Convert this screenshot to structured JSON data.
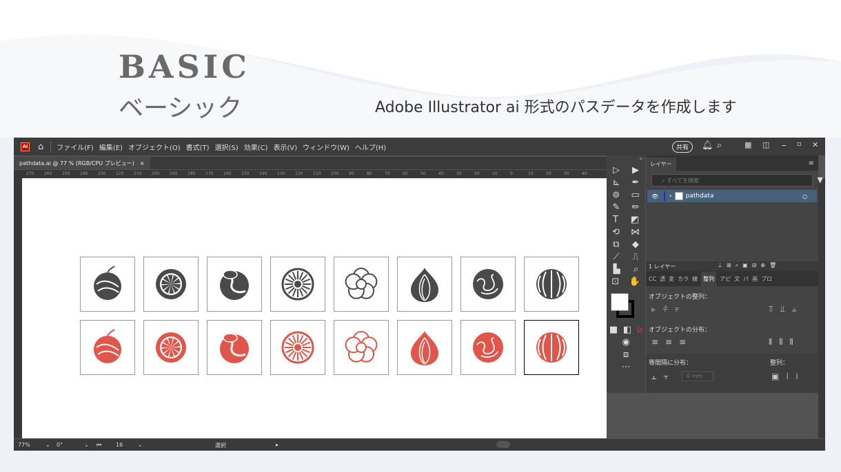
{
  "hero": {
    "title_en": "BASIC",
    "title_jp": "ベーシック",
    "subtitle": "Adobe Illustrator ai 形式のパスデータを作成します"
  },
  "app": {
    "logo": "Ai",
    "menu": [
      "ファイル(F)",
      "編集(E)",
      "オブジェクト(O)",
      "書式(T)",
      "選択(S)",
      "効果(C)",
      "表示(V)",
      "ウィンドウ(W)",
      "ヘルプ(H)"
    ],
    "share_label": "共有",
    "doc_tab": "pathdata.ai @ 77 % (RGB/CPU プレビュー)",
    "doc_tab_close": "×",
    "ruler_ticks": [
      "270",
      "260",
      "250",
      "240",
      "230",
      "220",
      "210",
      "200",
      "190",
      "180",
      "170",
      "160",
      "150",
      "140",
      "130",
      "120",
      "110",
      "100",
      "90",
      "80",
      "70",
      "60",
      "50",
      "40",
      "30",
      "20",
      "10",
      "0",
      "10",
      "20",
      "30",
      "40"
    ],
    "status": {
      "zoom": "77%",
      "rotate": "0°",
      "artboard": "16",
      "tool": "選択"
    }
  },
  "layers_panel": {
    "tab": "レイヤー",
    "search_placeholder": "すべてを検索",
    "layer_name": "pathdata",
    "layer_count": "1 レイヤー"
  },
  "align_panel": {
    "tabs": [
      "CC",
      "透",
      "変",
      "カラ",
      "線",
      "整列",
      "アピ",
      "文",
      "パ",
      "画",
      "プロ"
    ],
    "active_tab": "整列",
    "align_objects": "オブジェクトの整列：",
    "distribute_objects": "オブジェクトの分布：",
    "distribute_spacing": "等間隔に分布：",
    "align_to": "整列：",
    "spacing_value": "0 mm"
  },
  "artwork": {
    "top_color": "#4a4a4a",
    "bottom_color": "#e0564a",
    "items": [
      "apple",
      "lemon-slice",
      "cut-fruit",
      "kiwi",
      "flower",
      "onion",
      "cabbage",
      "watermelon"
    ]
  }
}
